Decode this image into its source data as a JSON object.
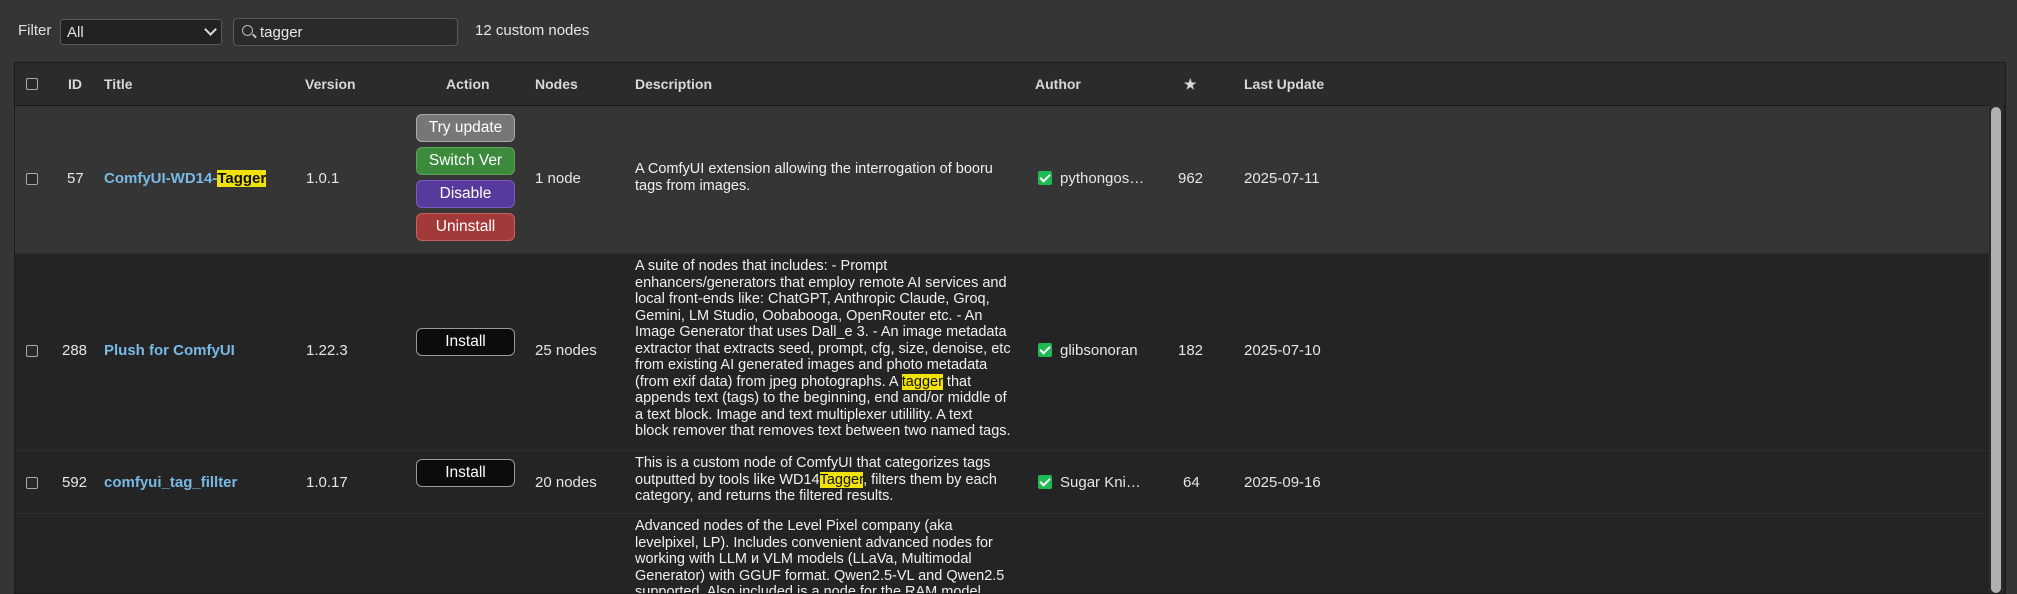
{
  "filter": {
    "label": "Filter",
    "selected": "All"
  },
  "search": {
    "value": "tagger",
    "count_text": "12 custom nodes"
  },
  "columns": {
    "id": "ID",
    "title": "Title",
    "version": "Version",
    "action": "Action",
    "nodes": "Nodes",
    "description": "Description",
    "author": "Author",
    "stars": "★",
    "last_update": "Last Update"
  },
  "rows": [
    {
      "id": "57",
      "title_pre": "ComfyUI-WD14-",
      "title_hl": "Tagger",
      "version": "1.0.1",
      "actions": [
        "Try update",
        "Switch Ver",
        "Disable",
        "Uninstall"
      ],
      "nodes": "1 node",
      "desc": [
        "A ComfyUI extension allowing the interrogation of booru",
        "tags from images."
      ],
      "author": "pythongos…",
      "stars": "962",
      "last_update": "2025-07-11"
    },
    {
      "id": "288",
      "title": "Plush for ComfyUI",
      "version": "1.22.3",
      "action": "Install",
      "nodes": "25 nodes",
      "desc": [
        "A suite of nodes that includes: - Prompt",
        "enhancers/generators that employ remote AI services and",
        "local front-ends like: ChatGPT, Anthropic Claude, Groq,",
        "Gemini, LM Studio, Oobabooga, OpenRouter etc. - An",
        "Image Generator that uses Dall_e 3. - An image metadata",
        "extractor that extracts seed, prompt, cfg, size, denoise, etc",
        "from existing AI generated images and photo metadata",
        "(from exif data) from jpeg photographs. A ",
        "tagger",
        " that",
        "appends text (tags) to the beginning, end and/or middle of",
        "a text block. Image and text multiplexer utilility. A text",
        "block remover that removes text between two named tags."
      ],
      "author": "glibsonoran",
      "stars": "182",
      "last_update": "2025-07-10"
    },
    {
      "id": "592",
      "title": "comfyui_tag_fillter",
      "version": "1.0.17",
      "action": "Install",
      "nodes": "20 nodes",
      "desc": [
        "This is a custom node of ComfyUI that categorizes tags",
        "outputted by tools like WD14",
        "Tagger",
        ", filters them by each",
        "category, and returns the filtered results."
      ],
      "author": "Sugar Kni…",
      "stars": "64",
      "last_update": "2025-09-16"
    },
    {
      "desc": [
        "Advanced nodes of the Level Pixel company (aka",
        "levelpixel, LP). Includes convenient advanced nodes for",
        "working with LLM и VLM models (LLaVa, Multimodal",
        "Generator) with GGUF format. Qwen2.5-VL and Qwen2.5",
        "supported. Also included is a node for the RAM model"
      ]
    }
  ]
}
